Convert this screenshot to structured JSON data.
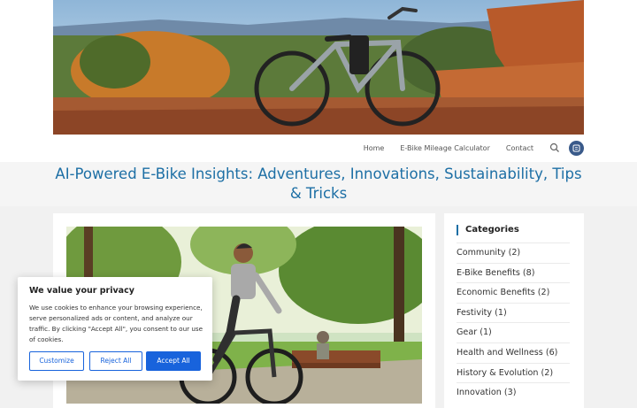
{
  "nav": {
    "items": [
      "Home",
      "E-Bike Mileage Calculator",
      "Contact"
    ],
    "search_icon": "search-icon",
    "menu_icon": "circle-menu-icon"
  },
  "page": {
    "title": "AI-Powered E-Bike Insights: Adventures, Innovations, Sustainability, Tips & Tricks"
  },
  "sidebar": {
    "heading": "Categories",
    "categories": [
      "Community (2)",
      "E-Bike Benefits (8)",
      "Economic Benefits (2)",
      "Festivity (1)",
      "Gear (1)",
      "Health and Wellness (6)",
      "History & Evolution (2)",
      "Innovation (3)"
    ]
  },
  "cookie": {
    "title": "We value your privacy",
    "text": "We use cookies to enhance your browsing experience, serve personalized ads or content, and analyze our traffic. By clicking \"Accept All\", you consent to our use of cookies.",
    "customize": "Customize",
    "reject": "Reject All",
    "accept": "Accept All"
  },
  "colors": {
    "accent": "#1d6fa5",
    "cookie_button": "#1863dc"
  }
}
